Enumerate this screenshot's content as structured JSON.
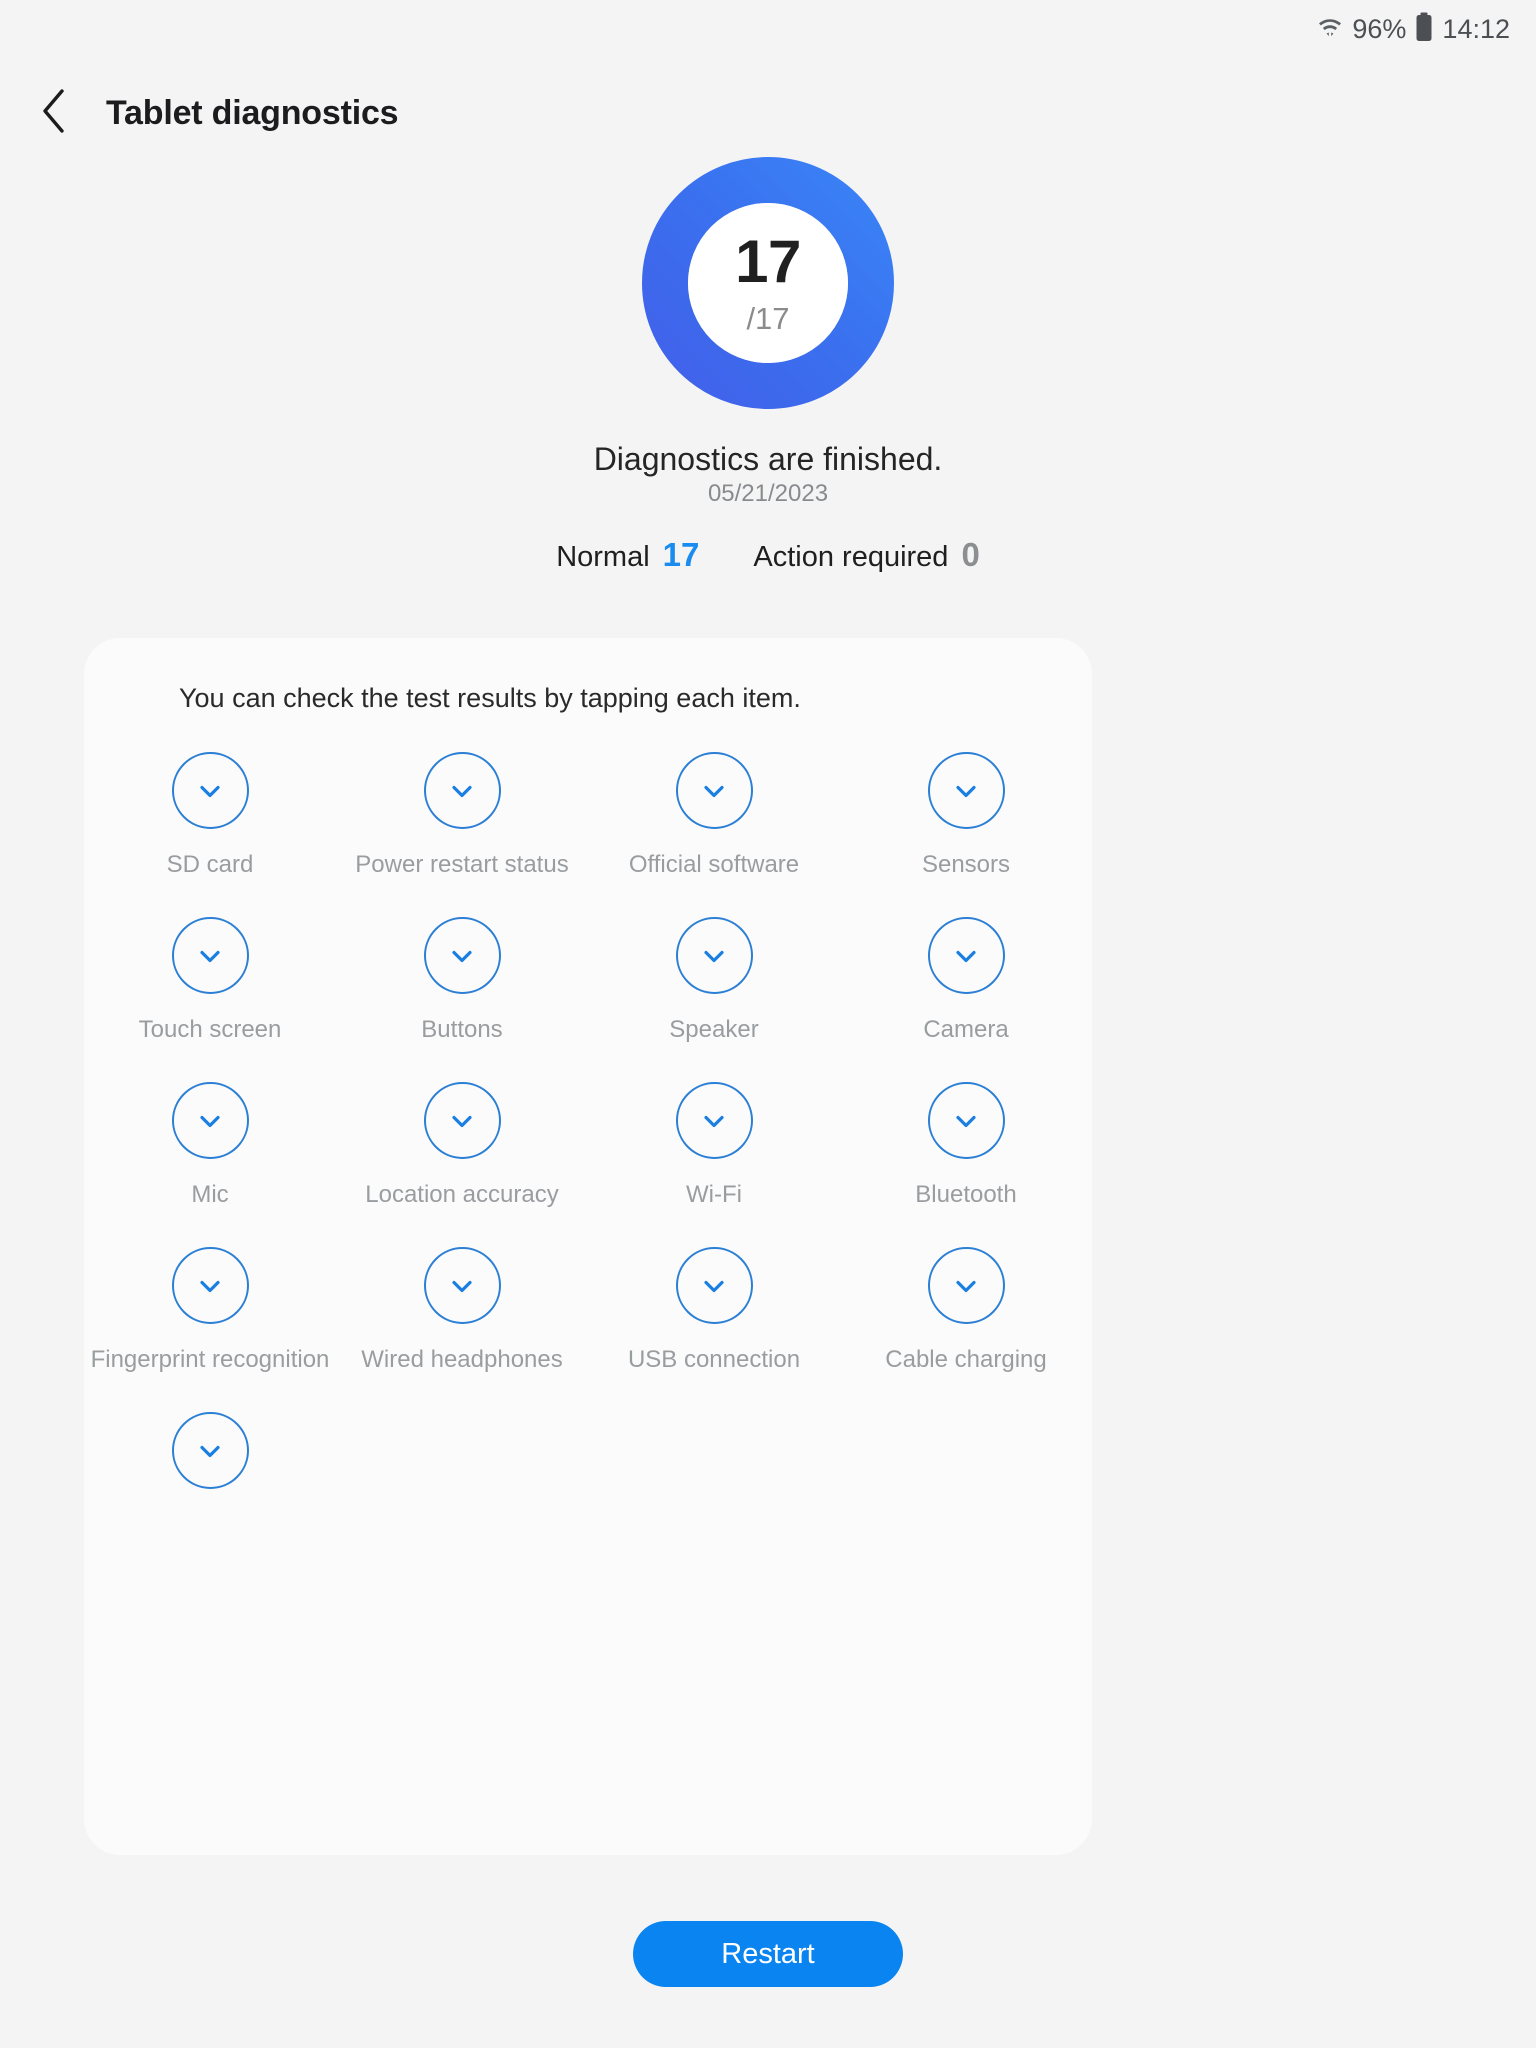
{
  "statusbar": {
    "wifi_icon": "wifi-icon",
    "battery_percent": "96%",
    "battery_icon": "battery-icon",
    "time": "14:12"
  },
  "header": {
    "back_icon": "back-chevron-icon",
    "title": "Tablet diagnostics"
  },
  "progress": {
    "completed": "17",
    "total": "/17",
    "ring_color_start": "#3f6fe8",
    "ring_color_end": "#3b7ef2",
    "percent": 100
  },
  "status": {
    "message": "Diagnostics are finished.",
    "date": "05/21/2023"
  },
  "counts": {
    "normal_label": "Normal",
    "normal_value": "17",
    "normal_color": "#1a8cf0",
    "action_label": "Action required",
    "action_value": "0",
    "action_color": "#8c8f92"
  },
  "card": {
    "hint": "You can check the test results by tapping each item.",
    "items": [
      {
        "label": "SD card",
        "icon": "check-icon",
        "status": "normal"
      },
      {
        "label": "Power restart status",
        "icon": "check-icon",
        "status": "normal"
      },
      {
        "label": "Official software",
        "icon": "check-icon",
        "status": "normal"
      },
      {
        "label": "Sensors",
        "icon": "check-icon",
        "status": "normal"
      },
      {
        "label": "Touch screen",
        "icon": "check-icon",
        "status": "normal"
      },
      {
        "label": "Buttons",
        "icon": "check-icon",
        "status": "normal"
      },
      {
        "label": "Speaker",
        "icon": "check-icon",
        "status": "normal"
      },
      {
        "label": "Camera",
        "icon": "check-icon",
        "status": "normal"
      },
      {
        "label": "Mic",
        "icon": "check-icon",
        "status": "normal"
      },
      {
        "label": "Location accuracy",
        "icon": "check-icon",
        "status": "normal"
      },
      {
        "label": "Wi-Fi",
        "icon": "check-icon",
        "status": "normal"
      },
      {
        "label": "Bluetooth",
        "icon": "check-icon",
        "status": "normal"
      },
      {
        "label": "Fingerprint recognition",
        "icon": "check-icon",
        "status": "normal"
      },
      {
        "label": "Wired headphones",
        "icon": "check-icon",
        "status": "normal"
      },
      {
        "label": "USB connection",
        "icon": "check-icon",
        "status": "normal"
      },
      {
        "label": "Cable charging",
        "icon": "check-icon",
        "status": "normal"
      },
      {
        "label": "",
        "icon": "check-icon",
        "status": "normal"
      }
    ]
  },
  "footer": {
    "restart_label": "Restart",
    "restart_color": "#0a84f0"
  }
}
